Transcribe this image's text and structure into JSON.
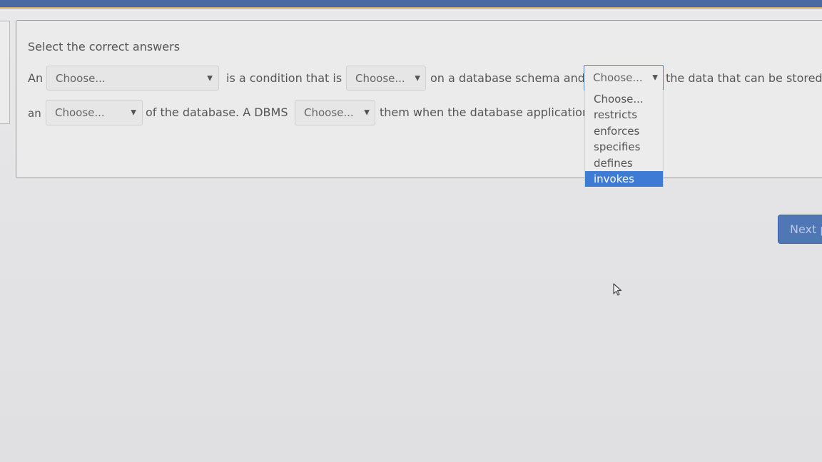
{
  "question": {
    "instruction": "Select the correct answers",
    "line1": {
      "w1": "An",
      "w2": "is a condition that is",
      "w3": "on a database schema and",
      "w4": "the data that can be stored in"
    },
    "line2": {
      "w1": "an",
      "w2": "of the database. A DBMS",
      "w3": "them when the database application"
    },
    "selects": {
      "s1": "Choose...",
      "s2": "Choose...",
      "s3": "Choose...",
      "s4": "Choose...",
      "s5": "Choose..."
    },
    "dropdown": {
      "options": [
        "Choose...",
        "restricts",
        "enforces",
        "specifies",
        "defines",
        "invokes"
      ],
      "highlighted": "invokes"
    }
  },
  "navigation": {
    "next_label": "Next p"
  },
  "icons": {
    "select_caret": "caret-down-icon",
    "mouse_pointer": "mouse-pointer-icon"
  },
  "colors": {
    "top_bar": "#4b6aa3",
    "highlight": "#3e7bd4",
    "next_button": "#4f76b5"
  }
}
